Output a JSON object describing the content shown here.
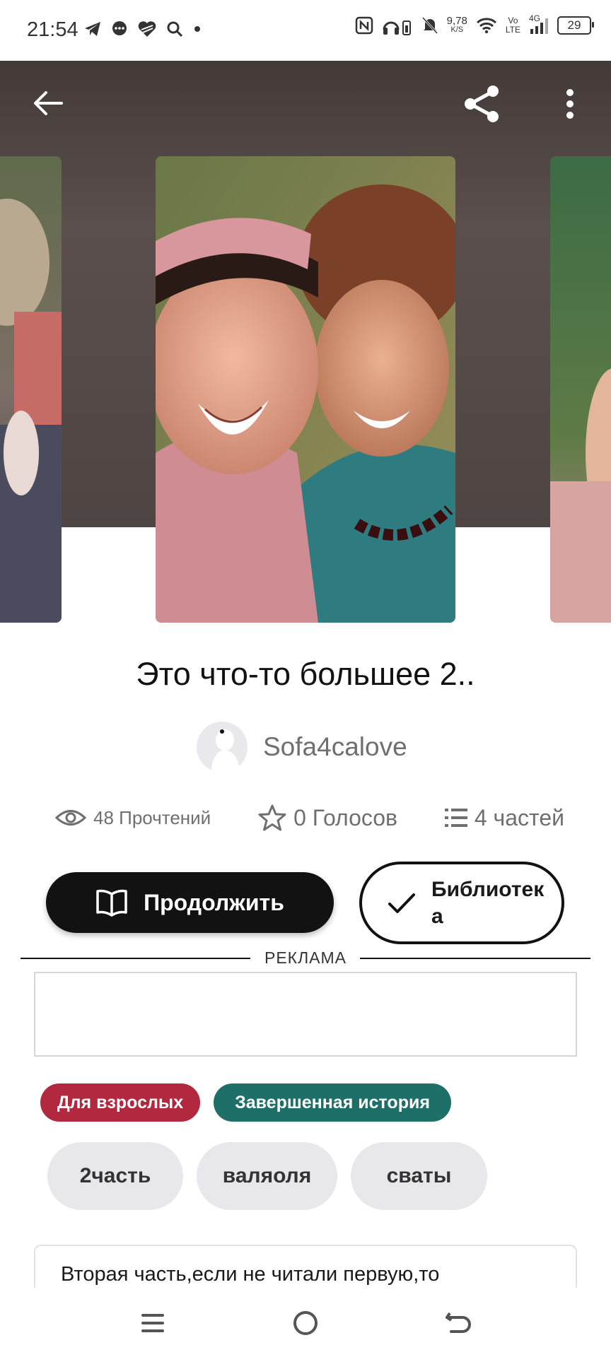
{
  "status_bar": {
    "time": "21:54",
    "net_speed_value": "9,78",
    "net_speed_unit": "K/S",
    "volte_top": "Vo",
    "volte_bottom": "LTE",
    "network": "4G",
    "battery": "29"
  },
  "header": {
    "bg_color": "#4b4240"
  },
  "story": {
    "title": "Это что-то большее 2..",
    "author": "Sofa4calove",
    "reads": "48 Прочтений",
    "votes": "0 Голосов",
    "parts": "4 частей"
  },
  "actions": {
    "continue_label": "Продолжить",
    "library_label": "Библиотека"
  },
  "ad": {
    "label": "РЕКЛАМА"
  },
  "tags": {
    "mature": "Для взрослых",
    "complete": "Завершенная история",
    "chips": [
      "2часть",
      "валяоля",
      "сваты"
    ]
  },
  "description": {
    "text": "Вторая часть,если не читали первую,то"
  },
  "colors": {
    "mature_tag": "#b2283e",
    "complete_tag": "#1e6f68",
    "primary_button": "#121212"
  }
}
